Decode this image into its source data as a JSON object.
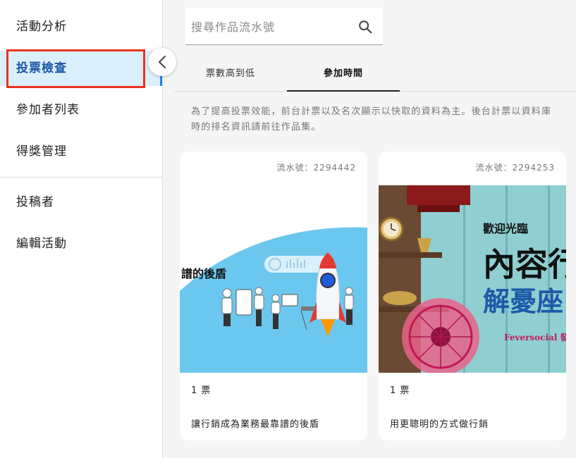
{
  "sidebar": {
    "items": [
      {
        "label": "活動分析"
      },
      {
        "label": "投票檢查",
        "active": true
      },
      {
        "label": "參加者列表"
      },
      {
        "label": "得獎管理"
      },
      {
        "label": "投稿者"
      },
      {
        "label": "編輯活動"
      }
    ],
    "collapse_icon": "chevron-left-icon"
  },
  "search": {
    "placeholder": "搜尋作品流水號",
    "value": "",
    "icon": "search-icon"
  },
  "tabs": [
    {
      "label": "票數高到低",
      "active": false
    },
    {
      "label": "參加時間",
      "active": true
    }
  ],
  "notice": {
    "line1": "為了提高投票效能，前台計票以及名次顯示以快取的資料為主。後台計票以資料庫",
    "line2": "時的排名資訊請前往作品集。"
  },
  "cards": [
    {
      "serial": "流水號：2294442",
      "votes": "1 票",
      "title": "讓行銷成為業務最靠譜的後盾",
      "cover_text": "譜的後盾"
    },
    {
      "serial": "流水號：2294253",
      "votes": "1 票",
      "title": "用更聰明的方式做行銷",
      "cover_text": {
        "welcome": "歡迎光臨",
        "big": "內容行",
        "sub": "解憂座",
        "brand": "Feversocial 發燒"
      }
    }
  ],
  "colors": {
    "accent": "#1e88e5",
    "active_bg": "#dbeffb",
    "highlight": "#e8351d",
    "teal": "#4fb3bf"
  }
}
